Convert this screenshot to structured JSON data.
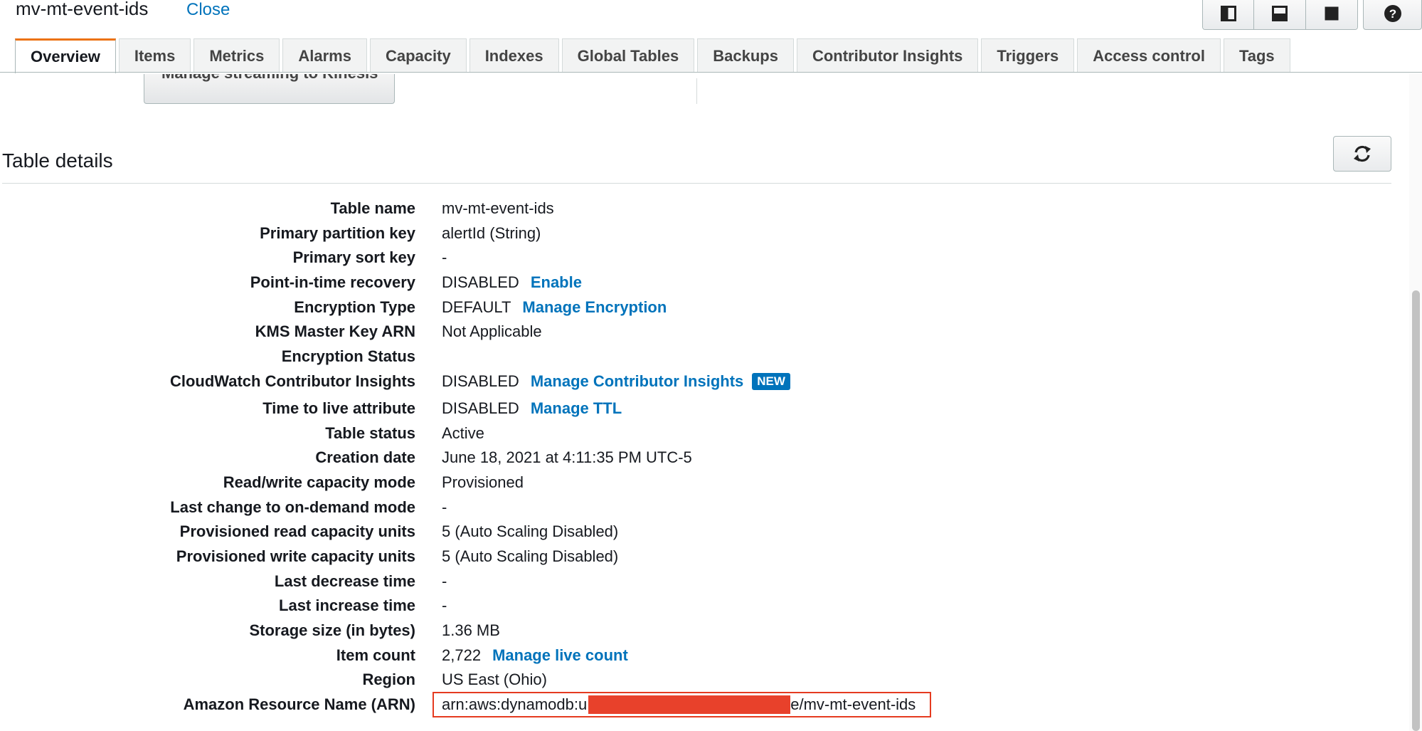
{
  "header": {
    "title": "mv-mt-event-ids",
    "close_label": "Close"
  },
  "layout_buttons": [
    "split-vertical-icon",
    "split-horizontal-icon",
    "full-panel-icon"
  ],
  "help_icon": "question-icon",
  "tabs": [
    {
      "label": "Overview",
      "active": true
    },
    {
      "label": "Items"
    },
    {
      "label": "Metrics"
    },
    {
      "label": "Alarms"
    },
    {
      "label": "Capacity"
    },
    {
      "label": "Indexes"
    },
    {
      "label": "Global Tables"
    },
    {
      "label": "Backups"
    },
    {
      "label": "Contributor Insights"
    },
    {
      "label": "Triggers"
    },
    {
      "label": "Access control"
    },
    {
      "label": "Tags"
    }
  ],
  "kinesis_button": "Manage streaming to Kinesis",
  "section": {
    "title": "Table details",
    "refresh_icon": "refresh-icon"
  },
  "details": [
    {
      "label": "Table name",
      "value": "mv-mt-event-ids"
    },
    {
      "label": "Primary partition key",
      "value": "alertId (String)"
    },
    {
      "label": "Primary sort key",
      "value": "-"
    },
    {
      "label": "Point-in-time recovery",
      "value": "DISABLED",
      "link": "Enable"
    },
    {
      "label": "Encryption Type",
      "value": "DEFAULT",
      "link": "Manage Encryption"
    },
    {
      "label": "KMS Master Key ARN",
      "value": "Not Applicable"
    },
    {
      "label": "Encryption Status",
      "value": ""
    },
    {
      "label": "CloudWatch Contributor Insights",
      "value": "DISABLED",
      "link": "Manage Contributor Insights",
      "badge": "NEW"
    },
    {
      "label": "Time to live attribute",
      "value": "DISABLED",
      "link": "Manage TTL"
    },
    {
      "label": "Table status",
      "value": "Active"
    },
    {
      "label": "Creation date",
      "value": "June 18, 2021 at 4:11:35 PM UTC-5"
    },
    {
      "label": "Read/write capacity mode",
      "value": "Provisioned"
    },
    {
      "label": "Last change to on-demand mode",
      "value": "-"
    },
    {
      "label": "Provisioned read capacity units",
      "value": "5 (Auto Scaling Disabled)"
    },
    {
      "label": "Provisioned write capacity units",
      "value": "5 (Auto Scaling Disabled)"
    },
    {
      "label": "Last decrease time",
      "value": "-"
    },
    {
      "label": "Last increase time",
      "value": "-"
    },
    {
      "label": "Storage size (in bytes)",
      "value": "1.36 MB"
    },
    {
      "label": "Item count",
      "value": "2,722",
      "link": "Manage live count"
    },
    {
      "label": "Region",
      "value": "US East (Ohio)"
    }
  ],
  "arn": {
    "label": "Amazon Resource Name (ARN)",
    "prefix": "arn:aws:dynamodb:u",
    "suffix": "e/mv-mt-event-ids"
  },
  "colors": {
    "link": "#0073bb",
    "active_tab_accent": "#ec7211",
    "highlight_box": "#e53b20",
    "redaction": "#e8412b"
  }
}
